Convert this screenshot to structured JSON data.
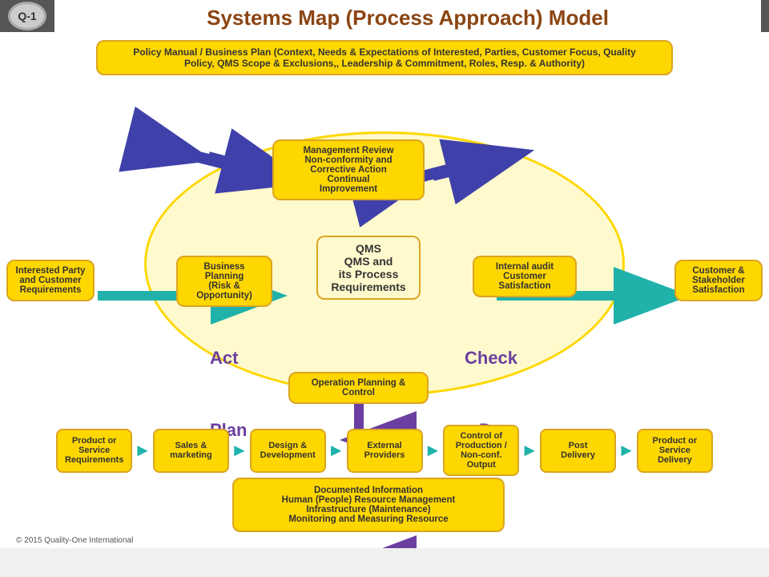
{
  "header": {
    "logo": "Q-1",
    "title": "Systems Map (Process Approach) Model"
  },
  "policy_banner": "Policy Manual / Business Plan (Context, Needs & Expectations of Interested, Parties, Customer Focus, Quality\nPolicy, QMS Scope & Exclusions,, Leadership & Commitment, Roles, Resp. & Authority)",
  "labels": {
    "act": "Act",
    "check": "Check",
    "plan": "Plan",
    "do": "Do"
  },
  "boxes": {
    "interested_party": "Interested Party\nand Customer\nRequirements",
    "customer_satisfaction": "Customer &\nStakeholder\nSatisfaction",
    "management_review": "Management Review\nNon-conformity and\nCorrective Action\nContinual\nImprovement",
    "qms": "QMS\nQMS and\nits Process\nRequirements",
    "business_planning": "Business\nPlanning\n(Risk &\nOpportunity)",
    "internal_audit": "Internal audit\nCustomer\nSatisfaction",
    "operation_planning": "Operation Planning &\nControl",
    "product_req": "Product or\nService\nRequirements",
    "sales": "Sales &\nmarketing",
    "design": "Design &\nDevelopment",
    "external": "External\nProviders",
    "control": "Control of\nProduction /\nNon-conf.\nOutput",
    "post": "Post\nDelivery",
    "product_delivery": "Product or\nService\nDelivery",
    "support": "Documented Information\nHuman (People) Resource Management\nInfrastructure (Maintenance)\nMonitoring and Measuring Resource"
  },
  "footer": "© 2015 Quality-One International"
}
